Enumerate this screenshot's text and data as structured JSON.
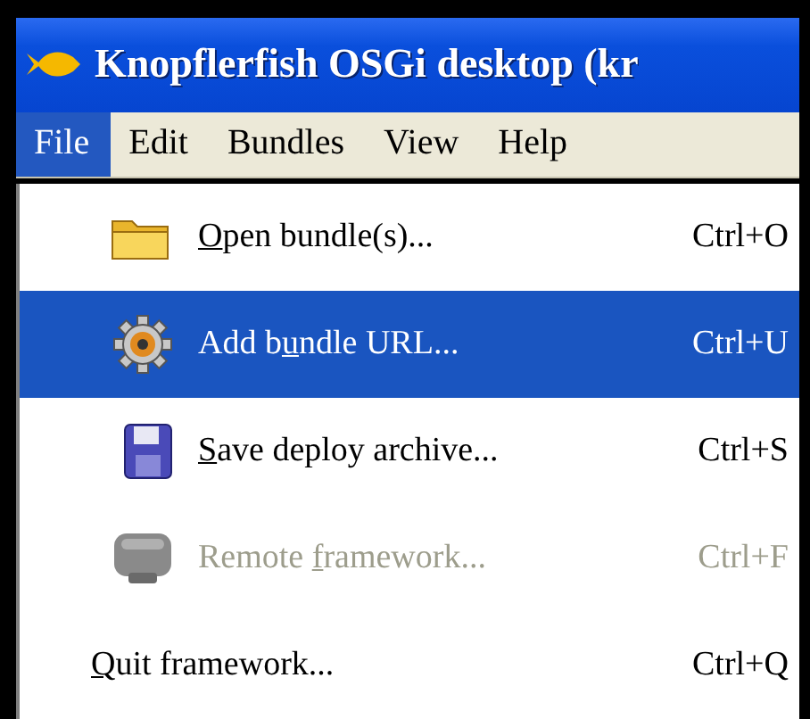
{
  "window": {
    "title": "Knopflerfish OSGi desktop (kr"
  },
  "menubar": [
    {
      "label": "File",
      "selected": true
    },
    {
      "label": "Edit",
      "selected": false
    },
    {
      "label": "Bundles",
      "selected": false
    },
    {
      "label": "View",
      "selected": false
    },
    {
      "label": "Help",
      "selected": false
    }
  ],
  "menu": [
    {
      "kind": "folder",
      "label": [
        {
          "text": "O",
          "underlined": true
        },
        {
          "text": "pen bundle(s)...",
          "underlined": false
        }
      ],
      "shortcut": "Ctrl+O",
      "selected": false,
      "disabled": false
    },
    {
      "kind": "gear",
      "label": [
        {
          "text": "Add b",
          "underlined": false
        },
        {
          "text": "u",
          "underlined": true
        },
        {
          "text": "ndle URL...",
          "underlined": false
        }
      ],
      "shortcut": "Ctrl+U",
      "selected": true,
      "disabled": false
    },
    {
      "kind": "disk",
      "label": [
        {
          "text": "S",
          "underlined": true
        },
        {
          "text": "ave deploy archive...",
          "underlined": false
        }
      ],
      "shortcut": "Ctrl+S",
      "selected": false,
      "disabled": false
    },
    {
      "kind": "remote",
      "label": [
        {
          "text": "Remote ",
          "underlined": false
        },
        {
          "text": "f",
          "underlined": true
        },
        {
          "text": "ramework...",
          "underlined": false
        }
      ],
      "shortcut": "Ctrl+F",
      "selected": false,
      "disabled": true
    },
    {
      "kind": "none",
      "label": [
        {
          "text": "Q",
          "underlined": true
        },
        {
          "text": "uit framework...",
          "underlined": false
        }
      ],
      "shortcut": "Ctrl+Q",
      "selected": false,
      "disabled": false
    }
  ]
}
